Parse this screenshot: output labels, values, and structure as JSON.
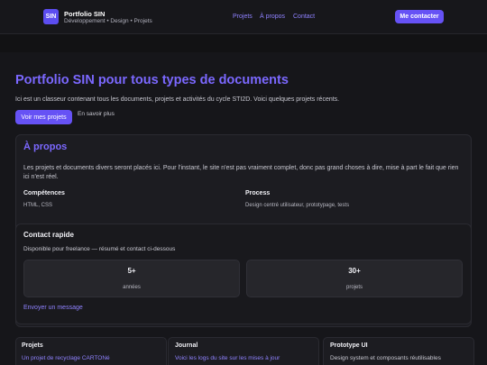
{
  "header": {
    "logo_text": "SIN",
    "brand_name": "Portfolio SIN",
    "brand_sub": "Développement • Design • Projets",
    "nav": [
      "Projets",
      "À propos",
      "Contact"
    ],
    "cta": "Me contacter"
  },
  "hero": {
    "title": "Portfolio SIN pour tous types de documents",
    "subtitle": "Ici est un classeur contenant tous les documents, projets et activités du cycle STI2D. Voici quelques projets récents.",
    "primary_button": "Voir mes projets",
    "secondary_link": "En savoir plus"
  },
  "about": {
    "title": "À propos",
    "description": "Les projets et documents divers seront placés ici. Pour l'instant, le site n'est pas vraiment complet, donc pas grand choses à dire, mise à part le fait que rien ici n'est réel.",
    "skills_heading": "Compétences",
    "skills_value": "HTML, CSS",
    "process_heading": "Process",
    "process_value": "Design centré utilisateur, prototypage, tests"
  },
  "contact": {
    "title": "Contact rapide",
    "subtitle": "Disponible pour freelance — résumé et contact ci-dessous",
    "stats": [
      {
        "value": "5+",
        "label": "années"
      },
      {
        "value": "30+",
        "label": "projets"
      }
    ],
    "message_link": "Envoyer un message"
  },
  "cards": [
    {
      "title": "Projets",
      "text": "Un projet de recyclage CARTONé"
    },
    {
      "title": "Journal",
      "text": "Voici les logs du site sur les mises à jour"
    },
    {
      "title": "Prototype UI",
      "text": "Design system et composants réutilisables"
    }
  ],
  "colors": {
    "background": "#121214",
    "accent": "#6652f5",
    "accent_text": "#7b68ff",
    "card": "#1c1c21"
  }
}
